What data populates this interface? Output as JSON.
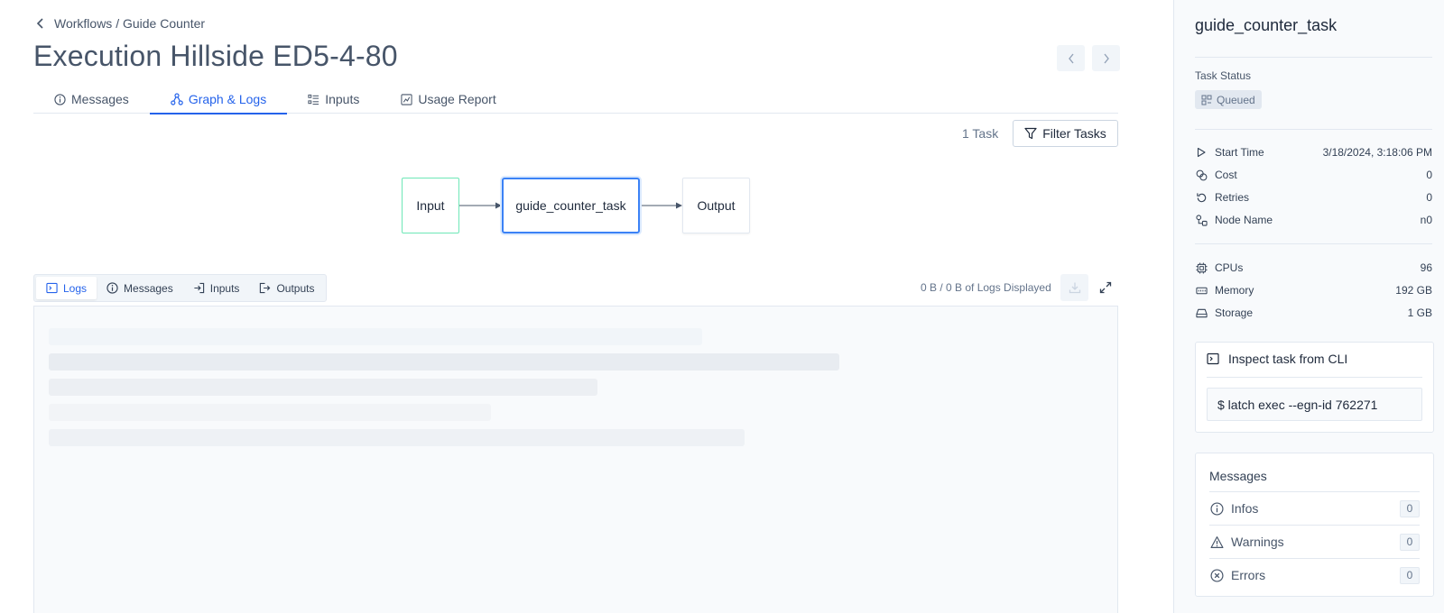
{
  "breadcrumb": {
    "path": "Workflows / Guide Counter"
  },
  "header": {
    "title": "Execution Hillside ED5-4-80"
  },
  "tabs": [
    {
      "label": "Messages",
      "icon": "info-icon"
    },
    {
      "label": "Graph & Logs",
      "icon": "graph-icon",
      "active": true
    },
    {
      "label": "Inputs",
      "icon": "list-icon"
    },
    {
      "label": "Usage Report",
      "icon": "chart-icon"
    }
  ],
  "graph": {
    "task_count": "1 Task",
    "filter_label": "Filter Tasks",
    "nodes": {
      "input": "Input",
      "task": "guide_counter_task",
      "output": "Output"
    }
  },
  "log_tabs": [
    {
      "label": "Logs",
      "icon": "terminal-icon",
      "active": true
    },
    {
      "label": "Messages",
      "icon": "info-icon"
    },
    {
      "label": "Inputs",
      "icon": "login-icon"
    },
    {
      "label": "Outputs",
      "icon": "logout-icon"
    }
  ],
  "logs": {
    "size_text": "0 B / 0 B of Logs Displayed"
  },
  "sidebar": {
    "title": "guide_counter_task",
    "status_label": "Task Status",
    "status_value": "Queued",
    "details": [
      {
        "label": "Start Time",
        "value": "3/18/2024, 3:18:06 PM",
        "icon": "play-icon"
      },
      {
        "label": "Cost",
        "value": "0",
        "icon": "coins-icon"
      },
      {
        "label": "Retries",
        "value": "0",
        "icon": "retry-icon"
      },
      {
        "label": "Node Name",
        "value": "n0",
        "icon": "node-icon"
      }
    ],
    "resources": [
      {
        "label": "CPUs",
        "value": "96",
        "icon": "cpu-icon"
      },
      {
        "label": "Memory",
        "value": "192 GB",
        "icon": "memory-icon"
      },
      {
        "label": "Storage",
        "value": "1 GB",
        "icon": "storage-icon"
      }
    ],
    "cli": {
      "title": "Inspect task from CLI",
      "command": "$ latch exec --egn-id 762271"
    },
    "messages": {
      "title": "Messages",
      "items": [
        {
          "label": "Infos",
          "count": "0",
          "icon": "info-icon"
        },
        {
          "label": "Warnings",
          "count": "0",
          "icon": "warning-icon"
        },
        {
          "label": "Errors",
          "count": "0",
          "icon": "error-icon"
        }
      ]
    }
  },
  "colors": {
    "accent": "#2563eb",
    "input_border": "#6ee7b7",
    "task_border": "#3b82f6"
  }
}
